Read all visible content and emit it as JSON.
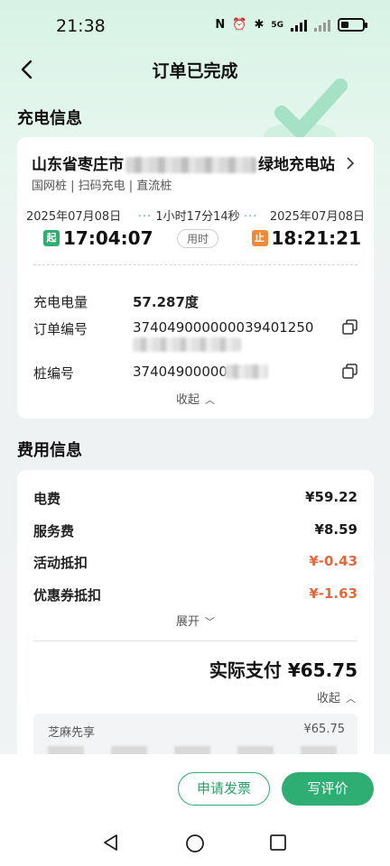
{
  "status": {
    "time": "21:38",
    "net": "5G"
  },
  "nav": {
    "title": "订单已完成"
  },
  "charge": {
    "section_title": "充电信息",
    "station_prefix": "山东省枣庄市",
    "station_suffix": "绿地充电站",
    "tags": "国网桩 | 扫码充电 | 直流桩",
    "start_date": "2025年07月08日",
    "end_date": "2025年07月08日",
    "duration": "1小时17分14秒",
    "start_badge": "起",
    "end_badge": "止",
    "start_time": "17:04:07",
    "end_time": "18:21:21",
    "duration_label": "用时",
    "amount_label": "充电电量",
    "amount_value": "57.287度",
    "order_label": "订单编号",
    "order_value": "374049000000039401250",
    "pile_label": "桩编号",
    "pile_value": "3740490000000",
    "collapse_label": "收起"
  },
  "fee": {
    "section_title": "费用信息",
    "electric_label": "电费",
    "electric_value": "¥59.22",
    "service_label": "服务费",
    "service_value": "¥8.59",
    "activity_label": "活动抵扣",
    "activity_value": "¥-0.43",
    "coupon_label": "优惠券抵扣",
    "coupon_value": "¥-1.63",
    "expand_label": "展开",
    "actual_text": "实际支付 ¥65.75",
    "collapse_label": "收起",
    "pay_method_label": "芝麻先享",
    "pay_method_value": "¥65.75"
  },
  "actions": {
    "invoice": "申请发票",
    "review": "写评价"
  },
  "colors": {
    "accent": "#2fae74",
    "negative": "#e5683c",
    "start_badge": "#2fae74",
    "end_badge": "#f08a3a"
  }
}
